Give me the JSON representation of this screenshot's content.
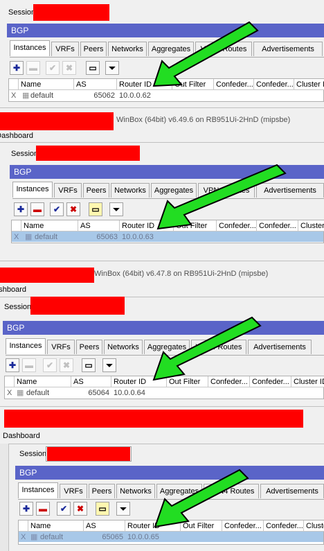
{
  "panels": [
    {
      "session_label": "Session:",
      "title": "BGP",
      "tabs": [
        "Instances",
        "VRFs",
        "Peers",
        "Networks",
        "Aggregates",
        "VPN4 Routes",
        "Advertisements"
      ],
      "toolbar_enabled": false,
      "columns": [
        "Name",
        "AS",
        "Router ID",
        "Out Filter",
        "Confeder...",
        "Confeder...",
        "Cluster ID"
      ],
      "row": {
        "flag": "X",
        "name": "default",
        "as": "65062",
        "router_id": "10.0.0.62"
      },
      "selected": false
    },
    {
      "winbox": "WinBox (64bit) v6.49.6 on RB951Ui-2HnD (mipsbe)",
      "dashboard": "Dashboard",
      "session_label": "Session:",
      "title": "BGP",
      "tabs": [
        "Instances",
        "VRFs",
        "Peers",
        "Networks",
        "Aggregates",
        "VPN4 Routes",
        "Advertisements"
      ],
      "toolbar_enabled": true,
      "columns": [
        "Name",
        "AS",
        "Router ID",
        "Out Filter",
        "Confeder...",
        "Confeder...",
        "Cluster"
      ],
      "row": {
        "flag": "X",
        "name": "default",
        "as": "65063",
        "router_id": "10.0.0.63"
      },
      "selected": true
    },
    {
      "winbox": "WinBox (64bit) v6.47.8 on RB951Ui-2HnD (mipsbe)",
      "dashboard": "Dashboard",
      "session_label": "Session:",
      "title": "BGP",
      "tabs": [
        "Instances",
        "VRFs",
        "Peers",
        "Networks",
        "Aggregates",
        "VPN4 Routes",
        "Advertisements"
      ],
      "toolbar_enabled": false,
      "columns": [
        "Name",
        "AS",
        "Router ID",
        "Out Filter",
        "Confeder...",
        "Confeder...",
        "Cluster ID"
      ],
      "row": {
        "flag": "X",
        "name": "default",
        "as": "65064",
        "router_id": "10.0.0.64"
      },
      "selected": false
    },
    {
      "dashboard": "Dashboard",
      "session_label": "Session:",
      "title": "BGP",
      "tabs": [
        "Instances",
        "VRFs",
        "Peers",
        "Networks",
        "Aggregates",
        "VPN4 Routes",
        "Advertisements"
      ],
      "toolbar_enabled": true,
      "columns": [
        "Name",
        "AS",
        "Router ID",
        "Out Filter",
        "Confeder...",
        "Confeder...",
        "Cluste"
      ],
      "row": {
        "flag": "X",
        "name": "default",
        "as": "65065",
        "router_id": "10.0.0.65"
      },
      "selected": true
    }
  ],
  "colors": {
    "title_bar": "#5a64c8",
    "redaction": "#ff0000",
    "arrow": "#22dd22",
    "selection": "#a8c8e8"
  }
}
